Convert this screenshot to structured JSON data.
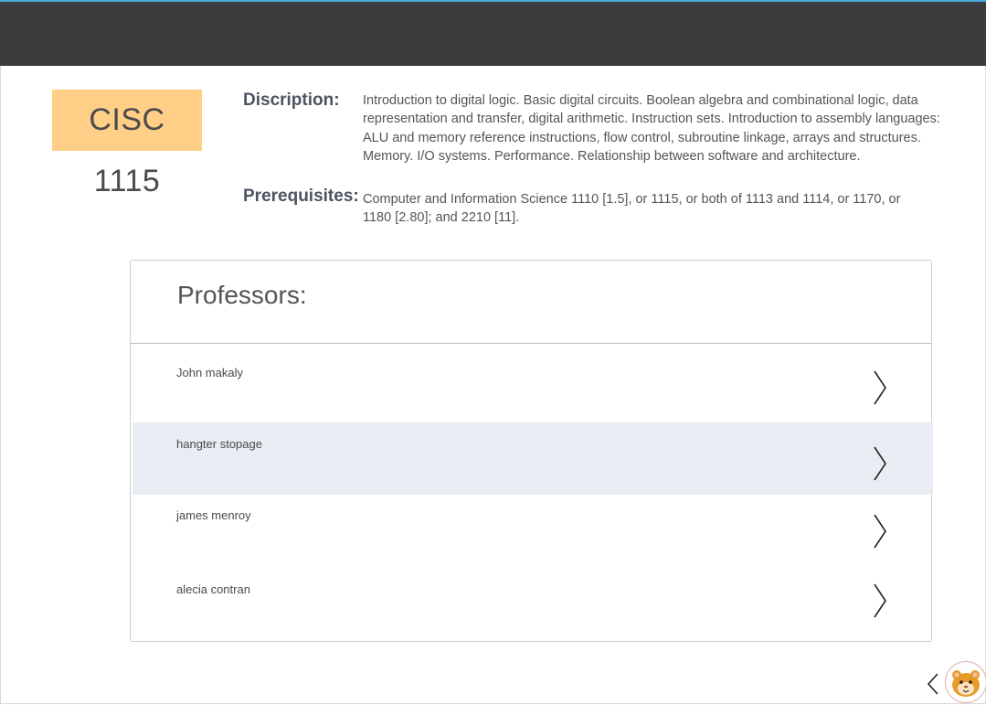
{
  "course": {
    "code": "CISC 1115"
  },
  "info": {
    "description_label": "Discription:",
    "description_text": "Introduction to digital logic. Basic digital circuits. Boolean algebra and combinational logic, data representation and transfer, digital arithmetic. Instruction sets. Introduction to assembly languages: ALU and memory reference instructions, flow control, subroutine linkage, arrays and structures. Memory. I/O systems. Performance. Relationship between software and architecture.",
    "prerequisites_label": "Prerequisites:",
    "prerequisites_text": "Computer and Information Science 1110 [1.5], or 1115, or both of 1113 and 1114, or 1170, or 1180 [2.80]; and 2210 [11]."
  },
  "professors": {
    "title": "Professors:",
    "items": [
      {
        "name": "John makaly"
      },
      {
        "name": "hangter stopage"
      },
      {
        "name": "james menroy"
      },
      {
        "name": "alecia contran"
      }
    ]
  },
  "colors": {
    "topbar": "#3b3c3e",
    "accent_line": "#4aa8d8",
    "course_badge": "#ffcf87",
    "highlight_row": "#e9ecf3"
  },
  "icons": {
    "row_arrow": "chevron-right-icon",
    "back": "chevron-left-icon",
    "avatar": "hamster-avatar-icon"
  }
}
